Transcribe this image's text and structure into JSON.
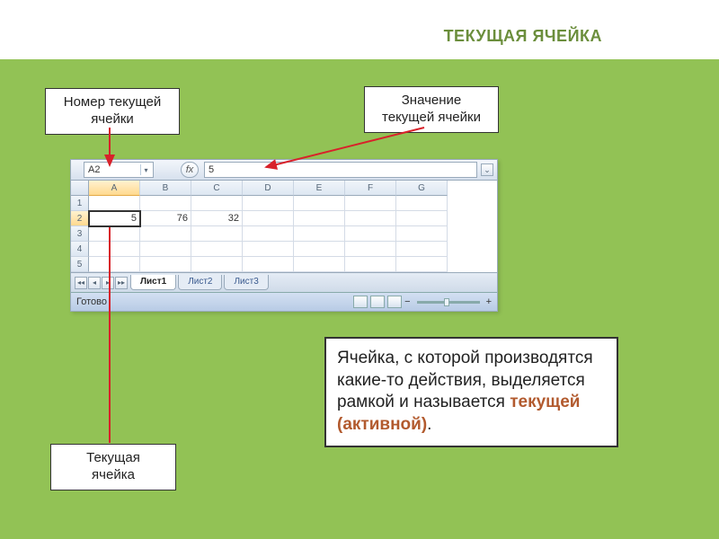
{
  "title": "ТЕКУЩАЯ ЯЧЕЙКА",
  "callouts": {
    "number": "Номер текущей ячейки",
    "value": "Значение текущей ячейки",
    "current": "Текущая ячейка"
  },
  "definition": {
    "text_before": "Ячейка, с которой производятся  какие-то действия, выделяется рамкой и называется ",
    "em": "текущей (активной)",
    "after": "."
  },
  "excel": {
    "name_box": "A2",
    "fx_label": "fx",
    "formula_value": "5",
    "columns": [
      "A",
      "B",
      "C",
      "D",
      "E",
      "F",
      "G"
    ],
    "rows": [
      "1",
      "2",
      "3",
      "4",
      "5"
    ],
    "cells": {
      "A2": "5",
      "B2": "76",
      "C2": "32"
    },
    "tabs": [
      "Лист1",
      "Лист2",
      "Лист3"
    ],
    "status": "Готово",
    "nav": {
      "first": "◂◂",
      "prev": "◂",
      "next": "▸",
      "last": "▸▸"
    },
    "zoom_minus": "−",
    "zoom_plus": "+"
  }
}
